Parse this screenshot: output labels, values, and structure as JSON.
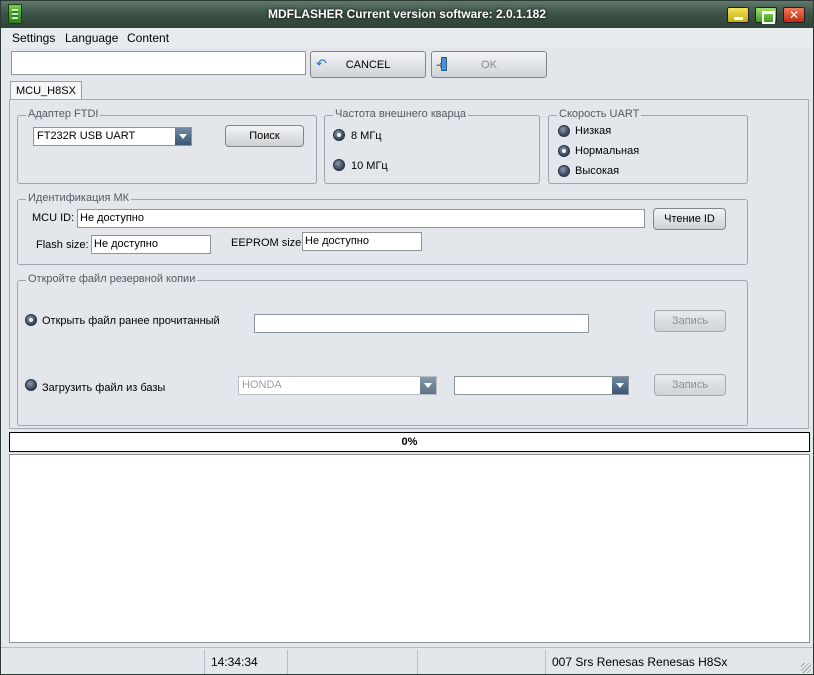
{
  "window": {
    "title": "MDFLASHER  Current version software: 2.0.1.182"
  },
  "menu": {
    "items": [
      "Settings",
      "Language",
      "Content"
    ]
  },
  "toolbar": {
    "input_value": "",
    "cancel_label": "CANCEL",
    "ok_label": "OK"
  },
  "tabs": [
    {
      "label": "MCU_H8SX"
    }
  ],
  "ftdi": {
    "legend": "Адаптер FTDI",
    "adapter_value": "FT232R USB UART",
    "search_label": "Поиск"
  },
  "quartz": {
    "legend": "Частота внешнего кварца",
    "options": [
      {
        "label": "8 МГц",
        "checked": true
      },
      {
        "label": "10 МГц",
        "checked": false
      }
    ]
  },
  "uart": {
    "legend": "Скорость UART",
    "options": [
      {
        "label": "Низкая",
        "checked": false
      },
      {
        "label": "Нормальная",
        "checked": true
      },
      {
        "label": "Высокая",
        "checked": false
      }
    ]
  },
  "ident": {
    "legend": "Идентификация МК",
    "mcu_id_label": "MCU ID:",
    "mcu_id_value": "Не доступно",
    "read_id_label": "Чтение ID",
    "flash_label": "Flash size:",
    "flash_value": "Не доступно",
    "eeprom_label": "EEPROM size:",
    "eeprom_value": "Не доступно"
  },
  "backup": {
    "legend": "Откройте файл резервной копии",
    "open_label": "Открыть файл ранее прочитанный",
    "open_path": "",
    "write_label": "Запись",
    "load_label": "Загрузить файл из базы",
    "brand_value": "HONDA",
    "model_value": "",
    "write2_label": "Запись"
  },
  "progress": {
    "text": "0%",
    "value": 0
  },
  "log": {
    "text": ""
  },
  "status": {
    "cells": [
      "",
      "14:34:34",
      "",
      "",
      "007 Srs Renesas Renesas H8Sx"
    ]
  }
}
